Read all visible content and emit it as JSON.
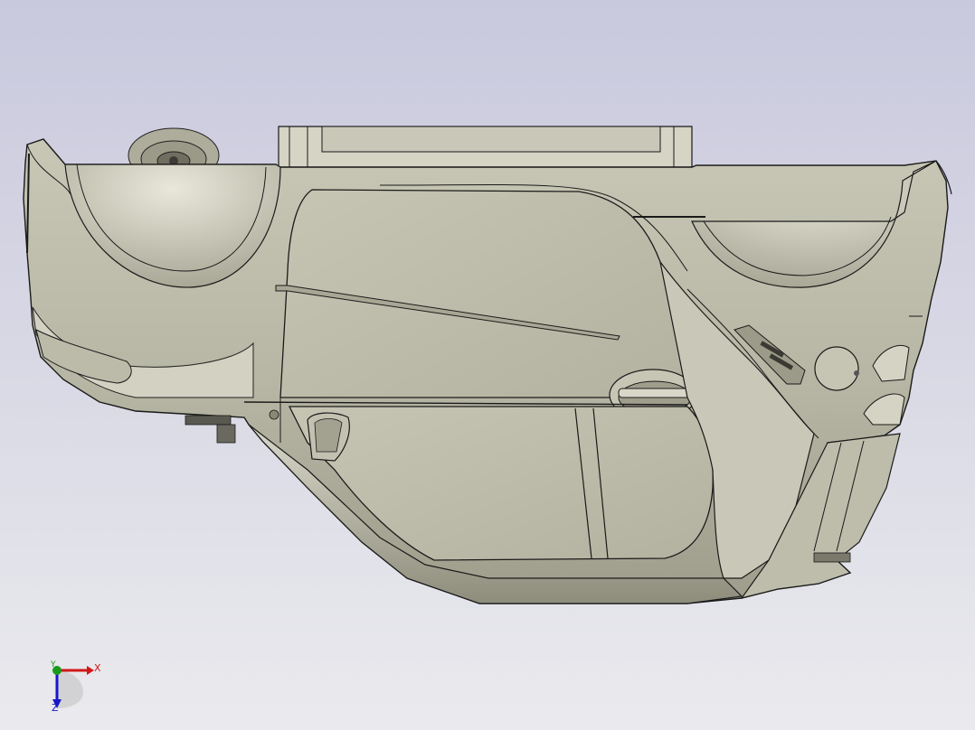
{
  "viewport": {
    "background_top": "#c9c9de",
    "background_bottom": "#eaeaee",
    "model_color": "#b5b4a2",
    "edge_color": "#1a1a1a"
  },
  "triad": {
    "x_label": "X",
    "y_label": "Y",
    "z_label": "Z",
    "x_color": "#d01818",
    "y_color": "#1a9a1a",
    "z_color": "#1818c8"
  }
}
